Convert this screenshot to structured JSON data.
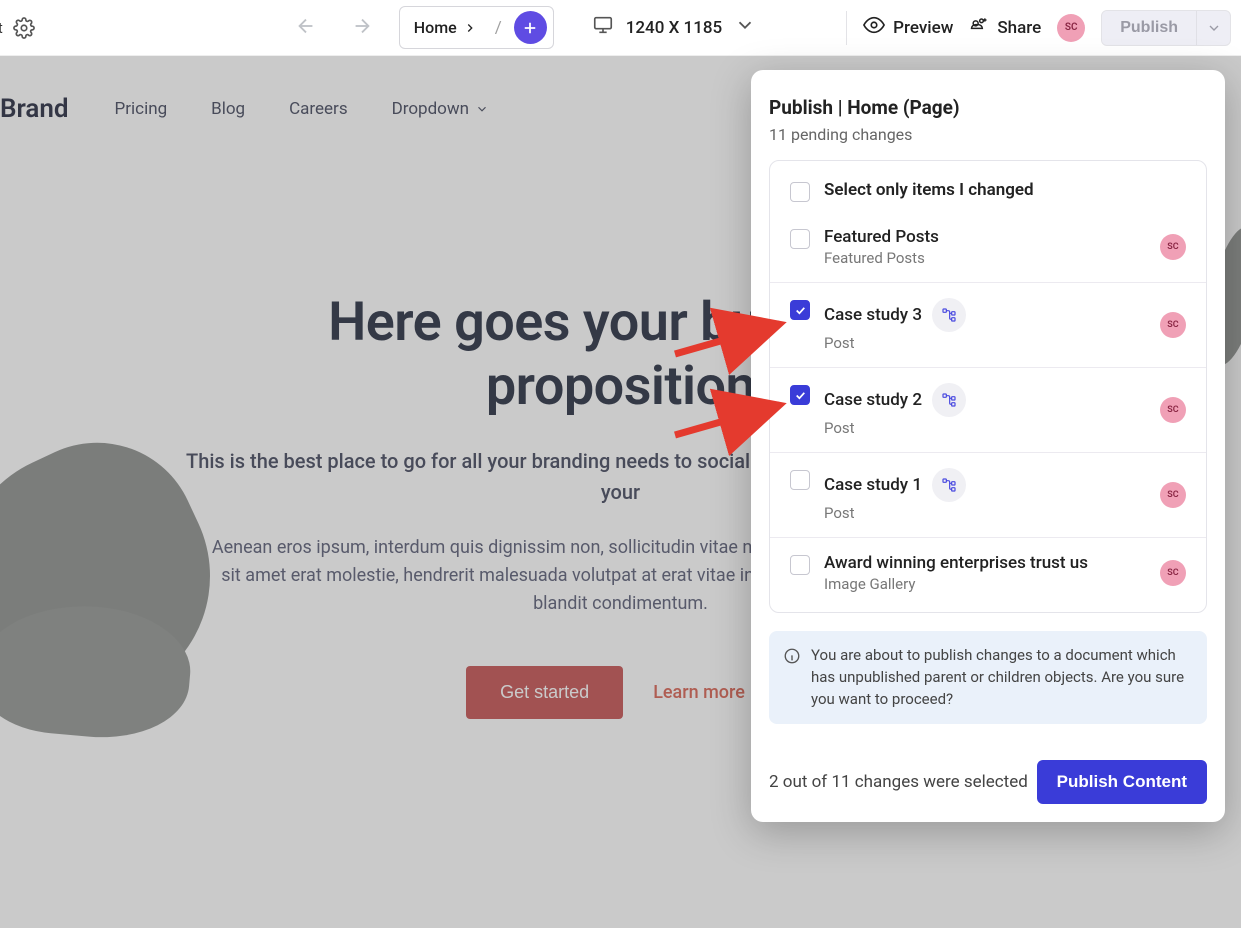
{
  "toolbar": {
    "left_trunc": "ct",
    "home_label": "Home",
    "viewport_text": "1240 X 1185",
    "preview_label": "Preview",
    "share_label": "Share",
    "avatar_initials": "SC",
    "publish_label": "Publish"
  },
  "page": {
    "brand": "Brand",
    "nav": {
      "pricing": "Pricing",
      "blog": "Blog",
      "careers": "Careers",
      "dropdown": "Dropdown"
    },
    "hero_h1_a": "Here goes your business ",
    "hero_h1_b": "proposition",
    "hero_sub": "This is the best place to go for all your branding needs to social media marketing, we can help get your ",
    "hero_p": "Aenean eros ipsum, interdum quis dignissim non, sollicitudin vitae nisl blandit ipsum. Sed eleifend felis sit amet erat molestie, hendrerit malesuada volutpat at erat vitae interdum. Ut nec massa eget lorem blandit condimentum.",
    "cta_primary": "Get started",
    "cta_link": "Learn more"
  },
  "popover": {
    "title": "Publish | Home (Page)",
    "subtitle": "11 pending changes",
    "select_all": "Select only items I changed",
    "items": {
      "0": {
        "title": "Featured Posts",
        "type": "Featured Posts"
      },
      "1": {
        "title": "Case study 3",
        "type": "Post"
      },
      "2": {
        "title": "Case study 2",
        "type": "Post"
      },
      "3": {
        "title": "Case study 1",
        "type": "Post"
      },
      "4": {
        "title": "Award winning enterprises trust us",
        "type": "Image Gallery"
      }
    },
    "avatar": "SC",
    "info": "You are about to publish changes to a document which has unpublished parent or children objects. Are you sure you want to proceed?",
    "foot_text": "2 out of 11 changes were selected",
    "publish_btn": "Publish Content"
  }
}
